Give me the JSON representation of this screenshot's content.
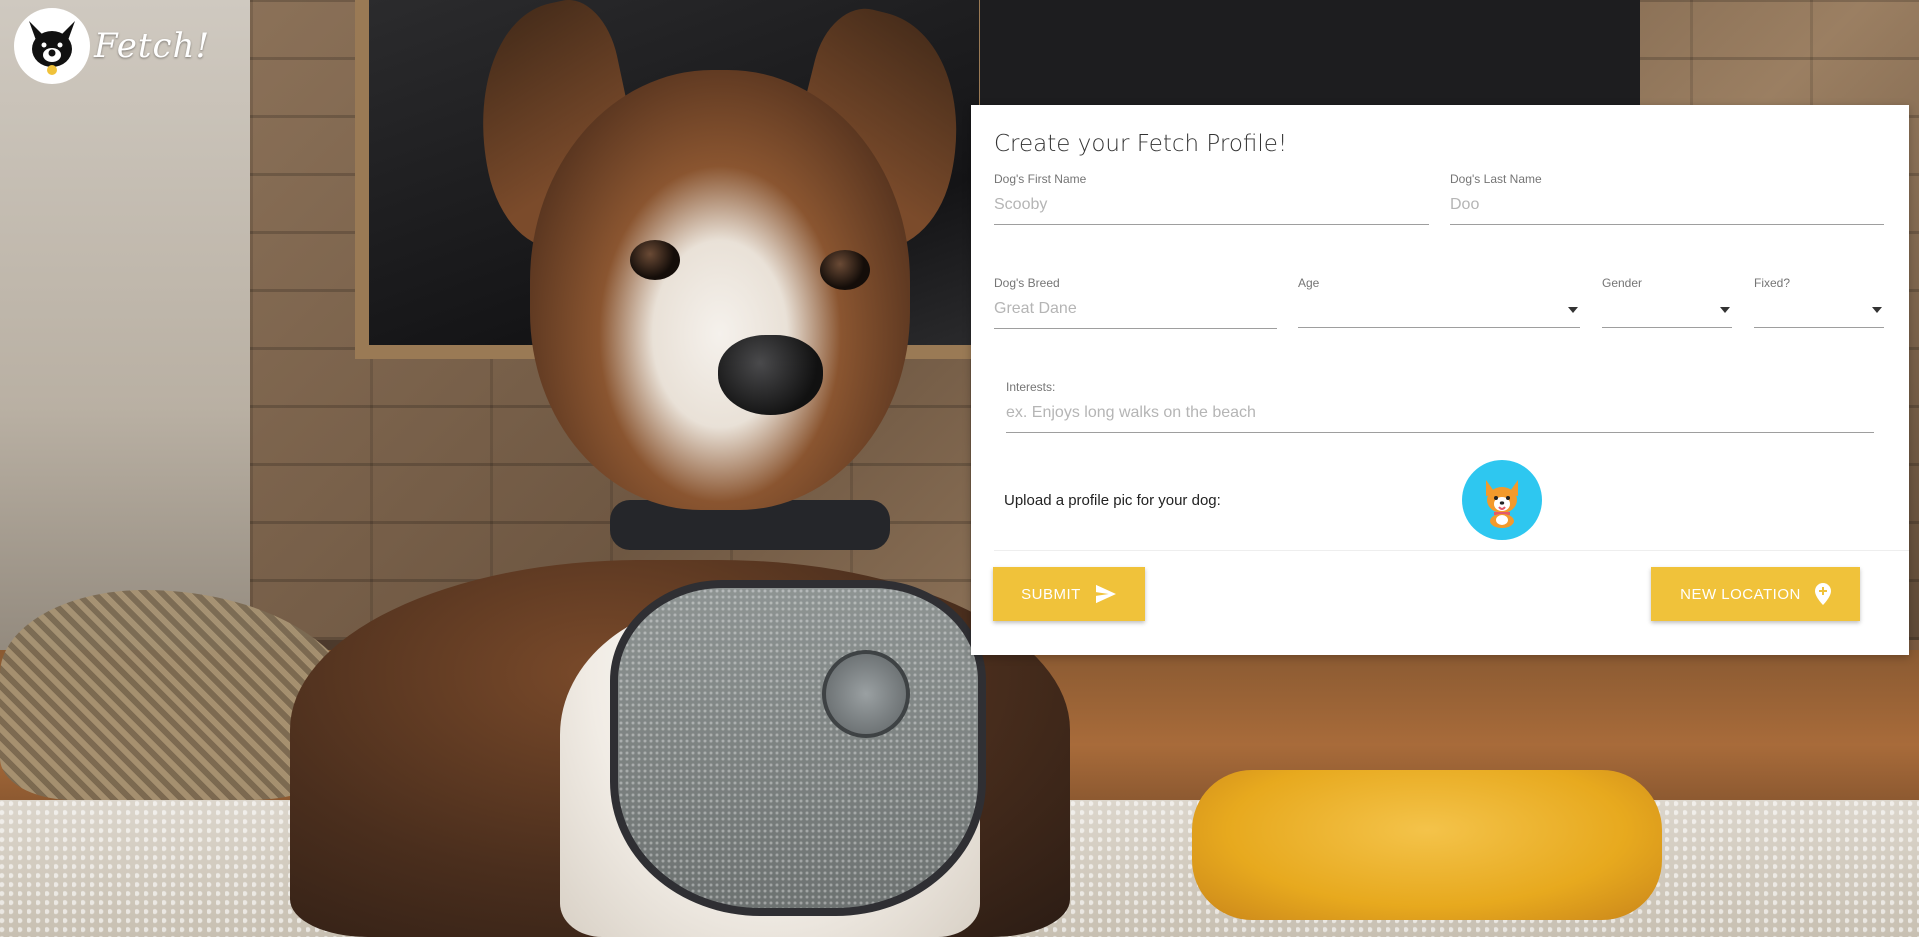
{
  "app": {
    "logo_text": "Fetch!"
  },
  "form": {
    "title": "Create your Fetch Profile!",
    "first_name": {
      "label": "Dog's First Name",
      "placeholder": "Scooby",
      "value": ""
    },
    "last_name": {
      "label": "Dog's Last Name",
      "placeholder": "Doo",
      "value": ""
    },
    "breed": {
      "label": "Dog's Breed",
      "placeholder": "Great Dane",
      "value": ""
    },
    "age": {
      "label": "Age",
      "selected": ""
    },
    "gender": {
      "label": "Gender",
      "selected": ""
    },
    "fixed": {
      "label": "Fixed?",
      "selected": ""
    },
    "interests": {
      "label": "Interests:",
      "placeholder": "ex. Enjoys long walks on the beach",
      "value": ""
    },
    "upload_label": "Upload a profile pic for your dog:",
    "upload_icon": "corgi-avatar-icon",
    "submit_label": "SUBMIT",
    "submit_icon": "send-icon",
    "location_label": "NEW LOCATION",
    "location_icon": "map-pin-add-icon"
  },
  "colors": {
    "accent": "#f0c23a",
    "avatar_bg": "#2ec7f0",
    "card_bg": "#ffffff"
  }
}
